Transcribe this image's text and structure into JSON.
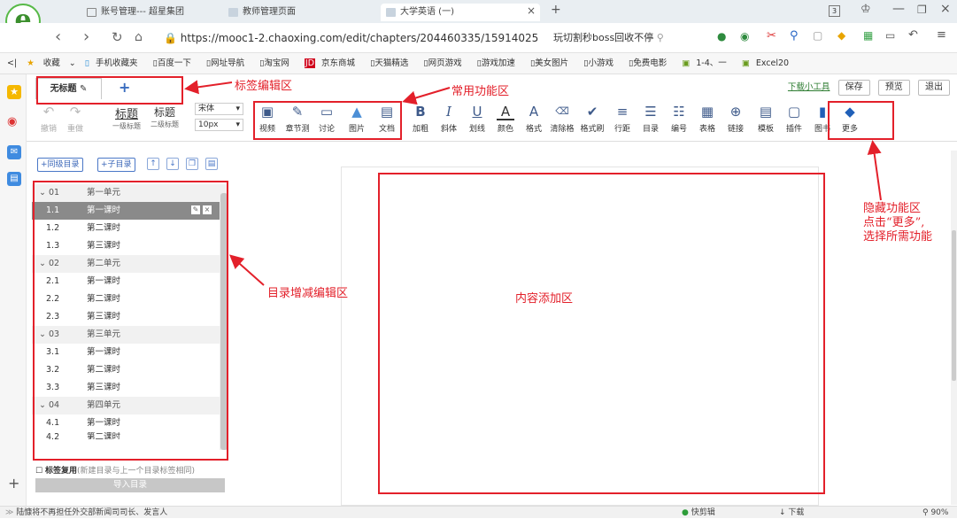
{
  "browser": {
    "tabs": [
      {
        "title": "账号管理--- 超星集团"
      },
      {
        "title": "教师管理页面"
      },
      {
        "title": "大学英语 (一)"
      }
    ],
    "tab_count": "3",
    "url": "https://mooc1-2.chaoxing.com/edit/chapters/204460335/15914025",
    "url_domain": "chaoxing.com",
    "search_suggestion": "玩切割秒boss回收不停",
    "bookmarks": [
      "收藏",
      "手机收藏夹",
      "百度一下",
      "网址导航",
      "淘宝网",
      "京东商城",
      "天猫精选",
      "网页游戏",
      "游戏加速",
      "美女图片",
      "小游戏",
      "免费电影",
      "1-4、一",
      "Excel20"
    ]
  },
  "editor": {
    "title_tab": "无标题",
    "add_tab": "+",
    "top_buttons": {
      "download": "下载小工具",
      "save": "保存",
      "preview": "预览",
      "exit": "退出"
    },
    "undo": "撤销",
    "redo": "重做",
    "heading1": "标题",
    "heading1_sub": "一级标题",
    "heading2": "标题",
    "heading2_sub": "二级标题",
    "font_name": "宋体",
    "font_size": "10px",
    "tools": [
      "视频",
      "章节测",
      "讨论",
      "图片",
      "文档",
      "加粗",
      "斜体",
      "划线",
      "颜色",
      "格式",
      "清除格",
      "格式刷",
      "行距",
      "目录",
      "编号",
      "表格",
      "链接",
      "模板",
      "插件",
      "图书",
      "更多"
    ]
  },
  "outline": {
    "add_same": "+同级目录",
    "add_child": "+子目录",
    "rows": [
      {
        "num": "01",
        "name": "第一单元",
        "type": "unit"
      },
      {
        "num": "1.1",
        "name": "第一课时",
        "type": "sel"
      },
      {
        "num": "1.2",
        "name": "第二课时",
        "type": "item"
      },
      {
        "num": "1.3",
        "name": "第三课时",
        "type": "item"
      },
      {
        "num": "02",
        "name": "第二单元",
        "type": "unit"
      },
      {
        "num": "2.1",
        "name": "第一课时",
        "type": "item"
      },
      {
        "num": "2.2",
        "name": "第二课时",
        "type": "item"
      },
      {
        "num": "2.3",
        "name": "第三课时",
        "type": "item"
      },
      {
        "num": "03",
        "name": "第三单元",
        "type": "unit"
      },
      {
        "num": "3.1",
        "name": "第一课时",
        "type": "item"
      },
      {
        "num": "3.2",
        "name": "第二课时",
        "type": "item"
      },
      {
        "num": "3.3",
        "name": "第三课时",
        "type": "item"
      },
      {
        "num": "04",
        "name": "第四单元",
        "type": "unit"
      },
      {
        "num": "4.1",
        "name": "第一课时",
        "type": "item"
      },
      {
        "num": "4.2",
        "name": "第二课时",
        "type": "item"
      }
    ],
    "reuse_label": "标签复用",
    "reuse_hint": "(新建目录与上一个目录标签相同)",
    "import_button": "导入目录"
  },
  "annotations": {
    "tag_area": "标签编辑区",
    "common_tools": "常用功能区",
    "outline_area": "目录增减编辑区",
    "content_area": "内容添加区",
    "hidden_line1": "隐藏功能区",
    "hidden_line2": "点击“更多”,",
    "hidden_line3": "选择所需功能",
    "color": "#e3202a"
  },
  "status_bar": {
    "news": "陆慷将不再担任外交部新闻司司长、发言人",
    "right": "快剪辑",
    "download": "下载",
    "zoom": "90%"
  }
}
